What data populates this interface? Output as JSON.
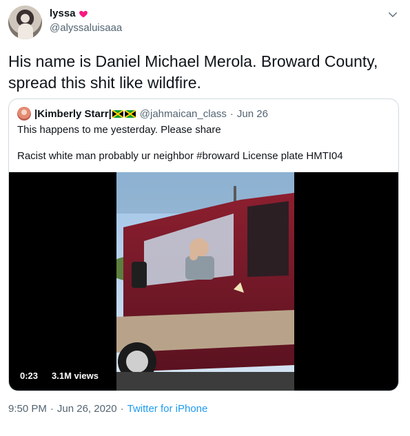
{
  "tweet": {
    "display_name": "lyssa",
    "handle": "@alyssaluisaaa",
    "text": "His name is Daniel Michael Merola. Broward County, spread this shit like wildfire.",
    "time": "9:50 PM",
    "date": "Jun 26, 2020",
    "separator": "·",
    "source": "Twitter for iPhone"
  },
  "quote": {
    "name_prefix": "|Kimberly Starr|",
    "handle": "@jahmaican_class",
    "separator": "·",
    "date": "Jun 26",
    "line1": "This happens to me yesterday. Please share",
    "line2": "Racist white man probably ur neighbor #broward License plate HMTI04"
  },
  "video": {
    "duration": "0:23",
    "views": "3.1M views"
  },
  "icons": {
    "heart": "heart-icon",
    "caret": "chevron-down-icon",
    "flag": "jamaica-flag-icon"
  },
  "colors": {
    "link": "#1d9bf0",
    "secondary_text": "#536471",
    "heart": "#f91880"
  }
}
